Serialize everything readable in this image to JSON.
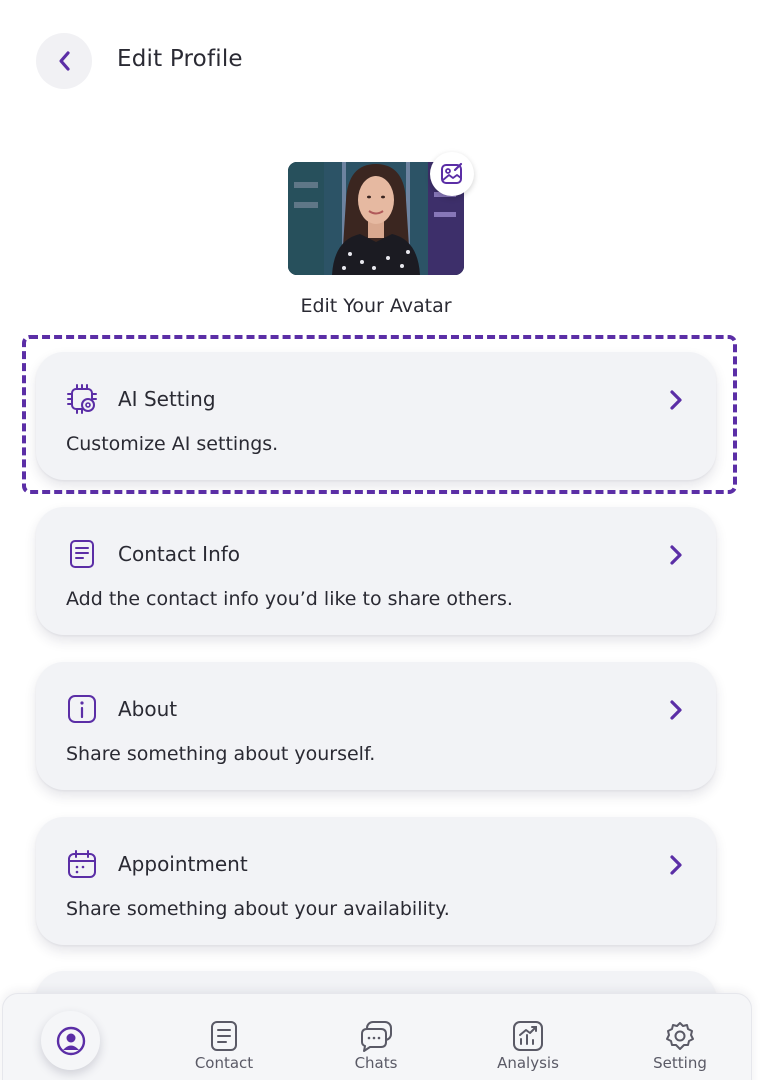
{
  "header": {
    "title": "Edit Profile"
  },
  "avatar": {
    "caption": "Edit Your Avatar"
  },
  "cards": [
    {
      "title": "AI Setting",
      "description": "Customize AI settings.",
      "icon": "ai-chip-gear-icon"
    },
    {
      "title": "Contact Info",
      "description": "Add the contact info you’d like to share others.",
      "icon": "document-icon"
    },
    {
      "title": "About",
      "description": "Share something about yourself.",
      "icon": "info-icon"
    },
    {
      "title": "Appointment",
      "description": "Share something about your availability.",
      "icon": "calendar-icon"
    }
  ],
  "bottom_nav": {
    "items": [
      {
        "label": "Contact",
        "icon": "contact-doc-icon"
      },
      {
        "label": "Chats",
        "icon": "chat-bubbles-icon"
      },
      {
        "label": "Analysis",
        "icon": "analysis-chart-icon"
      },
      {
        "label": "Setting",
        "icon": "gear-icon"
      }
    ],
    "active_icon": "profile-icon"
  },
  "colors": {
    "accent": "#5b2ea6",
    "card_bg": "#f2f3f6",
    "text": "#2a2a33"
  }
}
